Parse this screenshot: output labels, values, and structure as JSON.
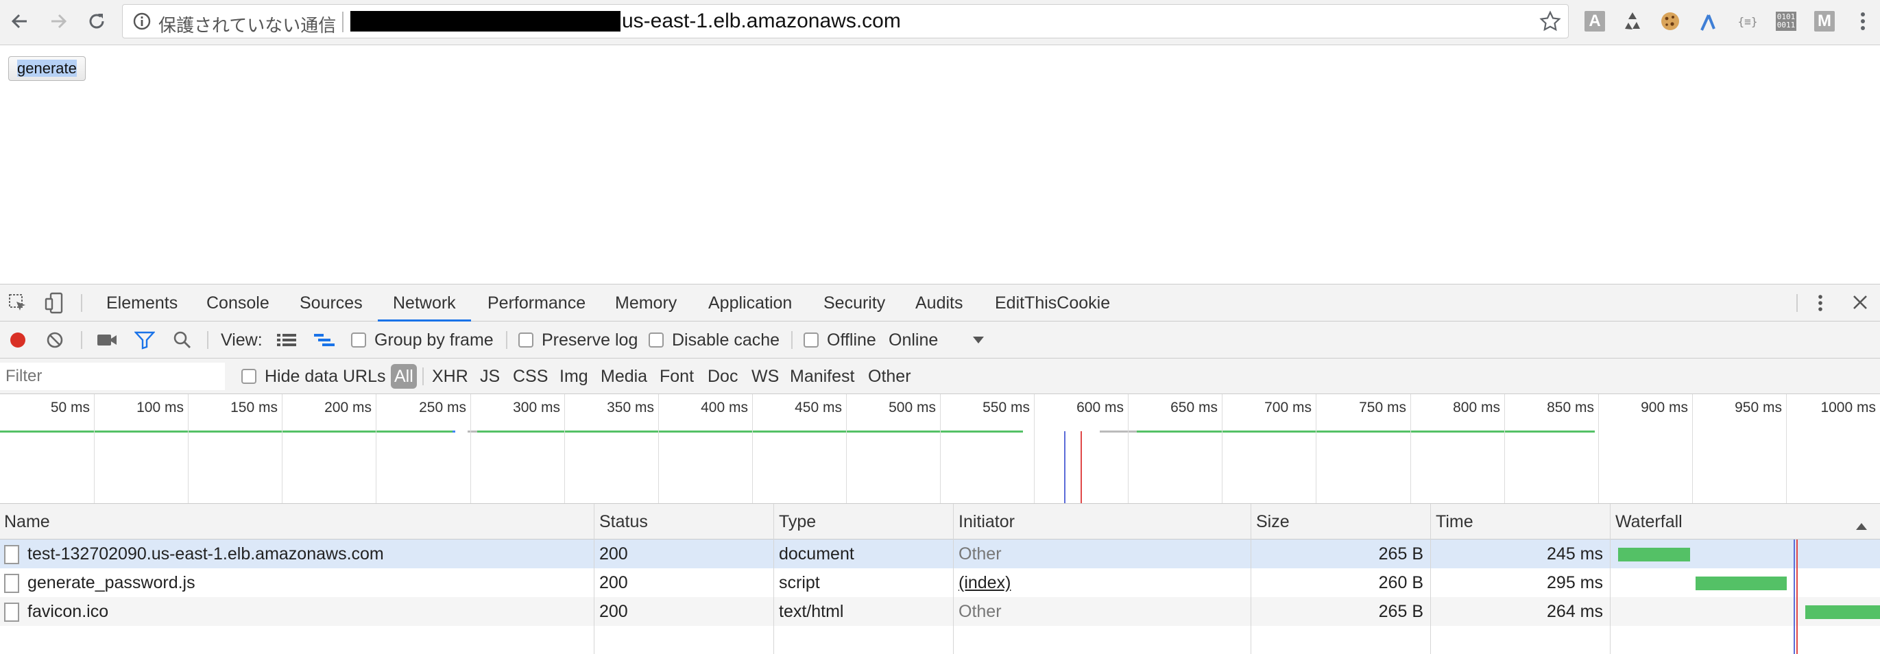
{
  "browser": {
    "security_label": "保護されていない通信",
    "url_visible": "us-east-1.elb.amazonaws.com"
  },
  "page": {
    "generate_label": "generate"
  },
  "devtools": {
    "tabs": [
      "Elements",
      "Console",
      "Sources",
      "Network",
      "Performance",
      "Memory",
      "Application",
      "Security",
      "Audits",
      "EditThisCookie"
    ],
    "active_tab": "Network",
    "toolbar": {
      "view_label": "View:",
      "group_by_frame": "Group by frame",
      "preserve_log": "Preserve log",
      "disable_cache": "Disable cache",
      "offline": "Offline",
      "throttle": "Online"
    },
    "filter": {
      "placeholder": "Filter",
      "hide_data_urls": "Hide data URLs",
      "types": [
        "All",
        "XHR",
        "JS",
        "CSS",
        "Img",
        "Media",
        "Font",
        "Doc",
        "WS",
        "Manifest",
        "Other"
      ]
    },
    "overview_ticks": [
      "50 ms",
      "100 ms",
      "150 ms",
      "200 ms",
      "250 ms",
      "300 ms",
      "350 ms",
      "400 ms",
      "450 ms",
      "500 ms",
      "550 ms",
      "600 ms",
      "650 ms",
      "700 ms",
      "750 ms",
      "800 ms",
      "850 ms",
      "900 ms",
      "950 ms",
      "1000 ms"
    ],
    "columns": [
      "Name",
      "Status",
      "Type",
      "Initiator",
      "Size",
      "Time",
      "Waterfall"
    ],
    "requests": [
      {
        "name": "test-132702090.us-east-1.elb.amazonaws.com",
        "status": "200",
        "type": "document",
        "initiator": "Other",
        "size": "265 B",
        "time": "245 ms",
        "wf_start": 0.02,
        "wf_end": 0.29
      },
      {
        "name": "generate_password.js",
        "status": "200",
        "type": "script",
        "initiator": "(index)",
        "size": "260 B",
        "time": "295 ms",
        "wf_start": 0.31,
        "wf_end": 0.65
      },
      {
        "name": "favicon.ico",
        "status": "200",
        "type": "text/html",
        "initiator": "Other",
        "size": "265 B",
        "time": "264 ms",
        "wf_start": 0.72,
        "wf_end": 1.0
      }
    ]
  }
}
